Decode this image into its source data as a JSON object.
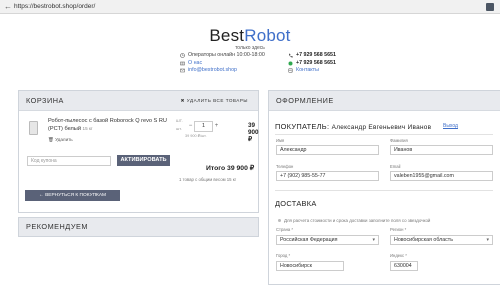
{
  "browser": {
    "url": "https://bestrobot.shop/order/"
  },
  "header": {
    "brand_part1": "Best",
    "brand_part2": "Robot",
    "tagline": "только здесь",
    "contacts_left": [
      {
        "icon": "clock-icon",
        "text": "Операторы онлайн 10:00-18:00"
      },
      {
        "icon": "map-icon",
        "text": "О нас"
      },
      {
        "icon": "email-icon",
        "text": "info@bestrobot.shop"
      }
    ],
    "contacts_right": [
      {
        "icon": "phone-icon",
        "text": "+7 929 568 5651"
      },
      {
        "icon": "whatsapp-icon",
        "text": "+7 929 568 5651"
      },
      {
        "icon": "contacts-icon",
        "text": "Контакты"
      }
    ]
  },
  "cart": {
    "title": "КОРЗИНА",
    "clear_all": "УДАЛИТЬ ВСЕ ТОВАРЫ",
    "item": {
      "name": "Робот-пылесос с базой Roborock Q revo S RU (PCT) белый",
      "weight": "15 кг",
      "remove": "Удалить",
      "qty_label": "ШТ.",
      "qty_label2": "шт.",
      "quantity": "1",
      "unit_price": "39 900 ₽/шт.",
      "line_price": "39 900 ₽"
    },
    "coupon_placeholder": "Код купона",
    "coupon_button": "АКТИВИРОВАТЬ",
    "total": "Итого 39 900 ₽",
    "total_sub": "1 товар с общим весом 15 кг",
    "back_button": "← ВЕРНУТЬСЯ К ПОКУПКАМ"
  },
  "recommend": {
    "title": "РЕКОМЕНДУЕМ"
  },
  "order": {
    "title": "ОФОРМЛЕНИЕ",
    "buyer_label": "ПОКУПАТЕЛЬ:",
    "buyer_name": "Александр Евгеньевич Иванов",
    "change_link": "Выход",
    "fields": {
      "first_name_label": "Имя",
      "first_name": "Александр",
      "last_name_label": "Фамилия",
      "last_name": "Иванов",
      "phone_label": "Телефон",
      "phone": "+7 (902) 985-55-77",
      "email_label": "Email",
      "email": "valeben1955@gmail.com"
    },
    "delivery_title": "ДОСТАВКА",
    "delivery_hint": "Для расчета стоимости и срока доставки заполните поля со звездочкой",
    "country_label": "Страна *",
    "country": "Российская Федерация",
    "region_label": "Регион *",
    "region": "Новосибирская область",
    "city_label": "Город *",
    "city": "Новосибирск",
    "index_label": "Индекс *",
    "index": "630004"
  },
  "colors": {
    "accent": "#3f6fc9",
    "button": "#5a6278",
    "panel_head": "#e8eaee"
  }
}
